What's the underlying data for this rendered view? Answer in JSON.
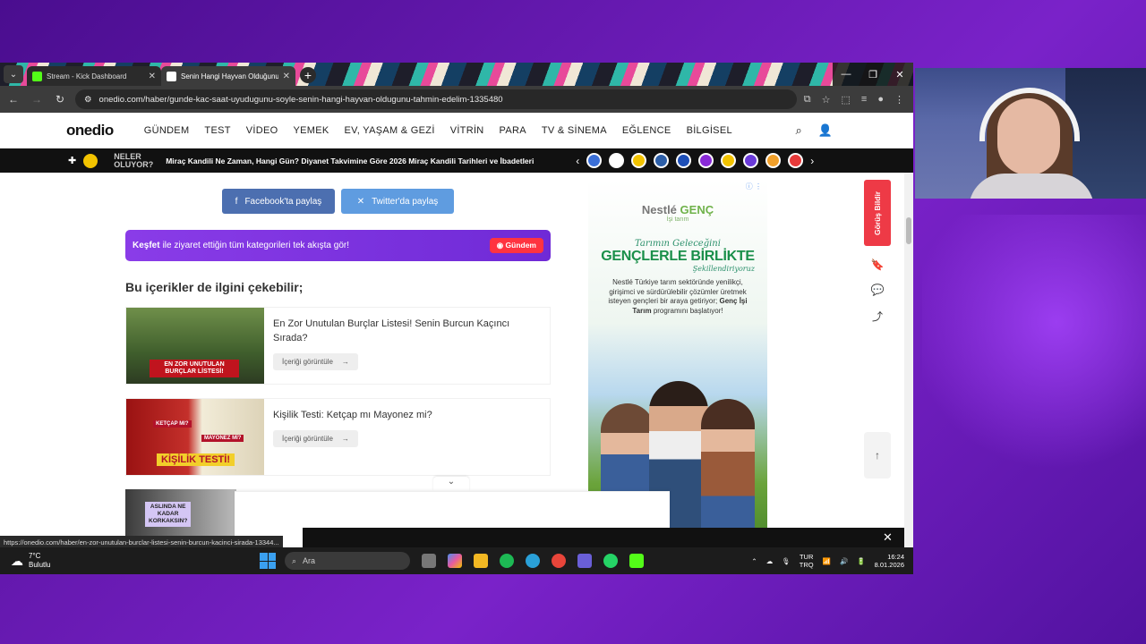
{
  "browser": {
    "tabs": [
      {
        "label": "Stream - Kick Dashboard",
        "active": false,
        "favicon_color": "#53fc18"
      },
      {
        "label": "Senin Hangi Hayvan Olduğunu",
        "active": true,
        "favicon_color": "#ffffff"
      }
    ],
    "url": "onedio.com/haber/gunde-kac-saat-uyudugunu-soyle-senin-hangi-hayvan-oldugunu-tahmin-edelim-1335480"
  },
  "site": {
    "logo": "onedio",
    "nav": [
      "GÜNDEM",
      "TEST",
      "VİDEO",
      "YEMEK",
      "EV, YAŞAM & GEZİ",
      "VİTRİN",
      "PARA",
      "TV & SİNEMA",
      "EĞLENCE",
      "BİLGİSEL"
    ],
    "ticker": {
      "label_line1": "NELER",
      "label_line2": "OLUYOR?",
      "headline": "Miraç Kandili Ne Zaman, Hangi Gün? Diyanet Takvimine Göre 2026 Miraç Kandili Tarihleri ve İbadetleri"
    }
  },
  "content": {
    "share_facebook": "Facebook'ta paylaş",
    "share_twitter": "Twitter'da paylaş",
    "kesfet_bold": "Keşfet",
    "kesfet_text": "ile ziyaret ettiğin tüm kategorileri tek akışta gör!",
    "gundem_button": "Gündem",
    "related_title": "Bu içerikler de ilgini çekebilir;",
    "cards": [
      {
        "title": "En Zor Unutulan Burçlar Listesi! Senin Burcun Kaçıncı Sırada?",
        "button": "İçeriği görüntüle",
        "thumb_text": "EN ZOR UNUTULAN BURÇLAR LİSTESİ!"
      },
      {
        "title": "Kişilik Testi: Ketçap mı Mayonez mi?",
        "button": "İçeriği görüntüle",
        "thumb_tag1": "KETÇAP MI?",
        "thumb_tag2": "MAYONEZ Mİ?",
        "thumb_text": "KİŞİLİK TESTİ!"
      },
      {
        "thumb_text_line1": "ASLINDA NE",
        "thumb_text_line2": "KADAR",
        "thumb_text_line3": "KORKAKSIN?"
      }
    ],
    "feedback_label": "Görüş Bildir",
    "status_url": "https://onedio.com/haber/en-zor-unutulan-burclar-listesi-senin-burcun-kacinci-sirada-13344..."
  },
  "ad": {
    "brand": "Nestlé",
    "brand2": "GENÇ",
    "brand_sub": "İşi tarım",
    "script1": "Tarımın Geleceğini",
    "headline": "GENÇLERLE BİRLİKTE",
    "script2": "Şekillendiriyoruz",
    "desc": "Nestlé Türkiye tarım sektöründe yenilikçi, girişimci ve sürdürülebilir çözümler üretmek isteyen gençleri bir araya getiriyor;",
    "desc_bold": "Genç İşi Tarım",
    "desc_tail": "programını başlatıyor!"
  },
  "taskbar": {
    "temp": "7°C",
    "weather": "Bulutlu",
    "search_placeholder": "Ara",
    "lang1": "TUR",
    "lang2": "TRQ",
    "time": "16:24",
    "date": "8.01.2026"
  }
}
